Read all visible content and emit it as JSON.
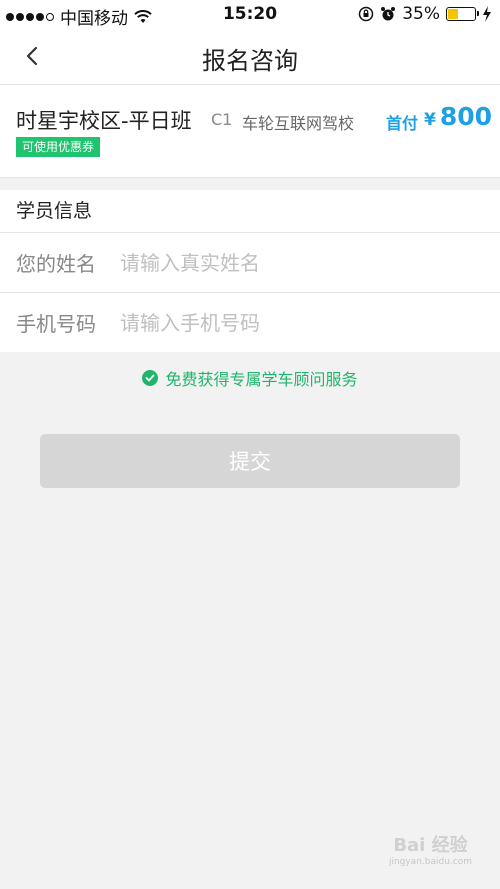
{
  "status_bar": {
    "carrier": "中国移动",
    "time": "15:20",
    "battery": "35%",
    "battery_level": 0.35
  },
  "nav": {
    "title": "报名咨询",
    "back_icon": "chevron-left-icon"
  },
  "course": {
    "name": "时星宇校区-平日班",
    "license_type": "C1",
    "school": "车轮互联网驾校",
    "price_label": "首付",
    "currency": "¥",
    "price": "800",
    "coupon_tag": "可使用优惠券"
  },
  "form": {
    "section_title": "学员信息",
    "name_label": "您的姓名",
    "name_placeholder": "请输入真实姓名",
    "name_value": "",
    "phone_label": "手机号码",
    "phone_placeholder": "请输入手机号码",
    "phone_value": ""
  },
  "service_note": "免费获得专属学车顾问服务",
  "submit_label": "提交",
  "watermark": {
    "text": "Bai 经验",
    "sub": "jingyan.baidu.com"
  },
  "colors": {
    "accent_blue": "#1fa0e6",
    "accent_green": "#1fc46e",
    "button_disabled": "#d6d6d6",
    "background": "#f2f2f2"
  }
}
